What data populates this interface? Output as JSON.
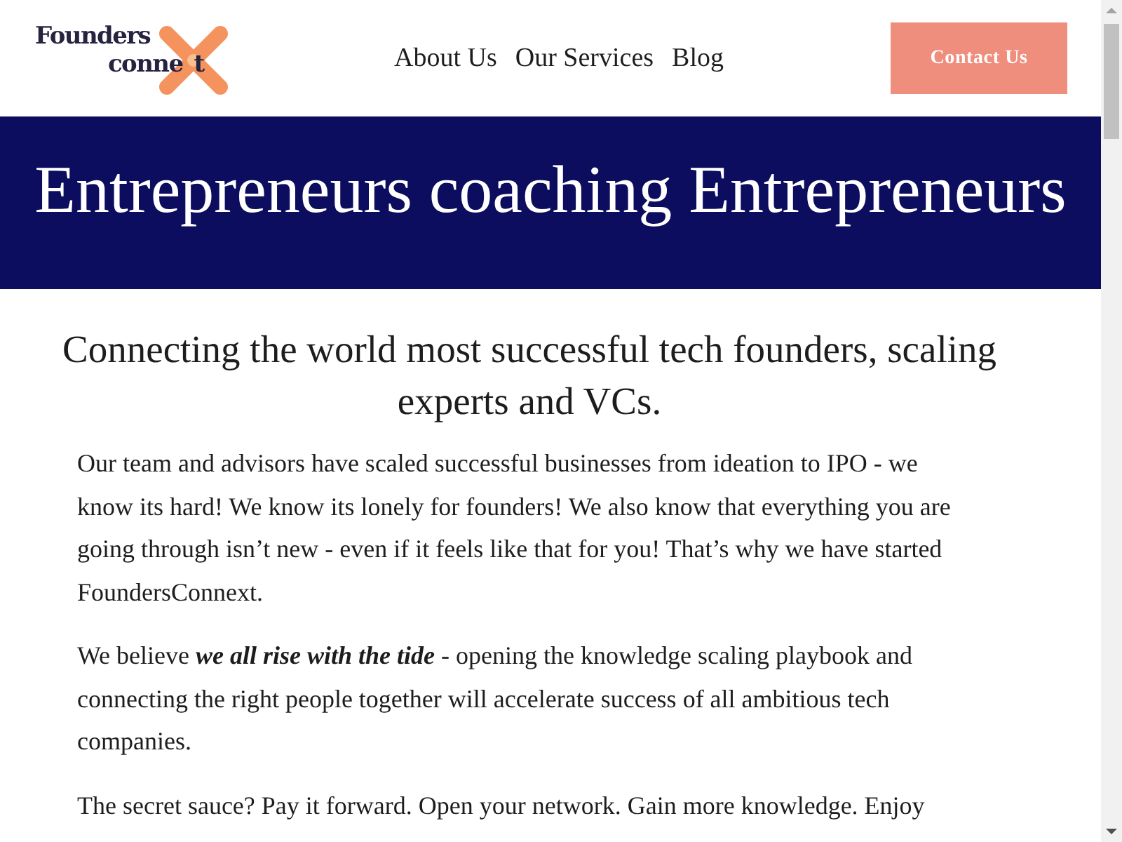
{
  "header": {
    "logo": {
      "line_1": "Founders",
      "line_2_start": "conne",
      "line_2_end": "t"
    },
    "nav": [
      {
        "label": "About Us"
      },
      {
        "label": "Our Services"
      },
      {
        "label": "Blog"
      }
    ],
    "cta": "Contact Us"
  },
  "hero": {
    "title": "Entrepreneurs coaching Entrepreneurs"
  },
  "intro": {
    "heading": "Connecting the world most successful tech founders, scaling experts and VCs.",
    "paragraphs": [
      "Our team and advisors have scaled successful businesses from ideation to IPO - we know its hard! We know its lonely for founders! We also know that everything you are going through isn’t new - even if it feels like that for you! That’s why we have started FoundersConnext.",
      "We believe **we all rise with the tide** - opening the knowledge scaling playbook and connecting the right people together will accelerate success of all ambitious tech companies.",
      "The secret sauce? Pay it forward. Open your network. Gain more knowledge. Enjoy"
    ]
  }
}
